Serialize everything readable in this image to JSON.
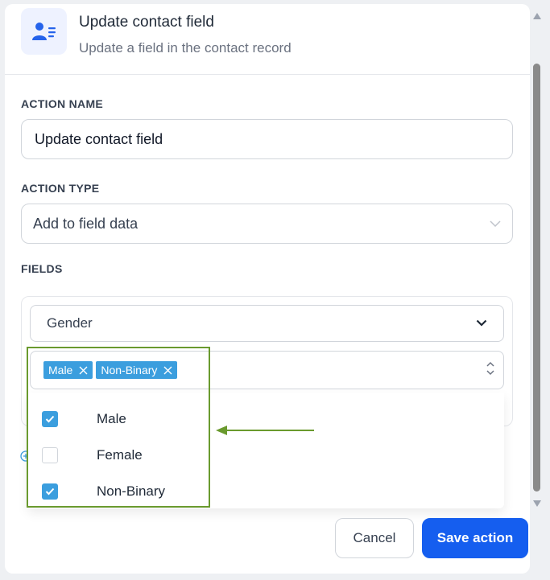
{
  "header": {
    "title": "Update contact field",
    "subtitle": "Update a field in the contact record",
    "icon": "contact-card-icon"
  },
  "action_name": {
    "label": "ACTION NAME",
    "value": "Update contact field"
  },
  "action_type": {
    "label": "ACTION TYPE",
    "value": "Add to field data",
    "icon": "chevron-down-icon"
  },
  "fields": {
    "label": "FIELDS",
    "field_select": "Gender",
    "chips": [
      {
        "label": "Male"
      },
      {
        "label": "Non-Binary"
      }
    ],
    "options": [
      {
        "label": "Male",
        "checked": true
      },
      {
        "label": "Female",
        "checked": false
      },
      {
        "label": "Non-Binary",
        "checked": true
      }
    ]
  },
  "footer": {
    "cancel_label": "Cancel",
    "save_label": "Save action"
  },
  "colors": {
    "accent": "#155eef",
    "chip": "#3b9ede",
    "highlight": "#6a9a2e"
  }
}
